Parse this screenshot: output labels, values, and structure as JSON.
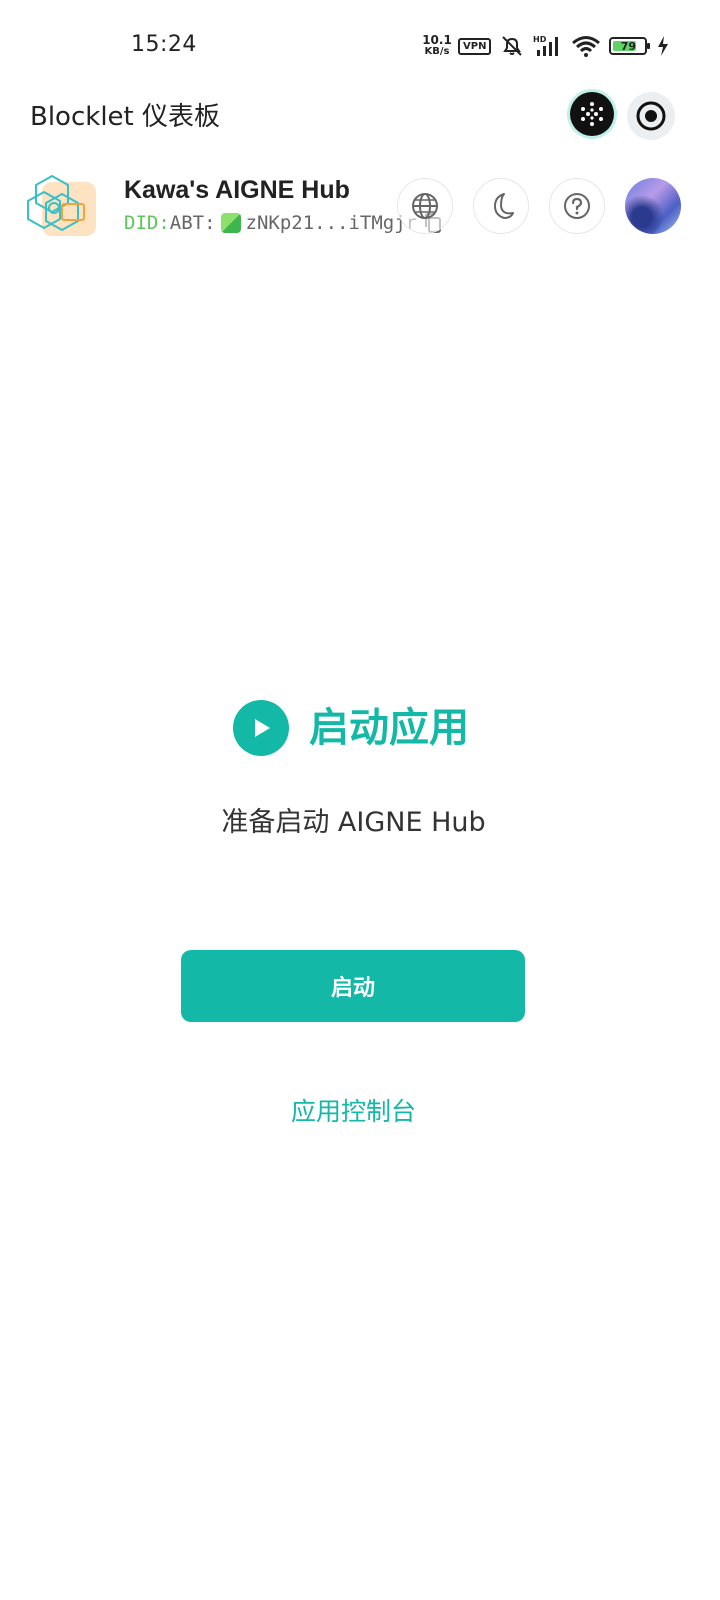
{
  "status_bar": {
    "time": "15:24",
    "net_speed_value": "10.1",
    "net_speed_unit": "KB/s",
    "vpn_label": "VPN",
    "signal_badge": "HD",
    "battery_percent": "79",
    "battery_level": 0.79
  },
  "app_bar": {
    "title": "Blocklet 仪表板"
  },
  "header": {
    "app_name": "Kawa's AIGNE Hub",
    "did_label": "DID:",
    "did_prefix": "ABT:",
    "did_value": "zNKp21...iTMgjr"
  },
  "main": {
    "title": "启动应用",
    "subtitle": "准备启动 AIGNE Hub",
    "start_button": "启动",
    "console_link": "应用控制台"
  },
  "colors": {
    "accent": "#14b8a6",
    "did_green": "#5cc65a"
  },
  "icons": {
    "mini_program": "dots-grid-icon",
    "close": "record-close-icon",
    "language": "globe-icon",
    "theme": "moon-icon",
    "help": "question-icon",
    "copy": "copy-icon",
    "play": "play-icon"
  }
}
